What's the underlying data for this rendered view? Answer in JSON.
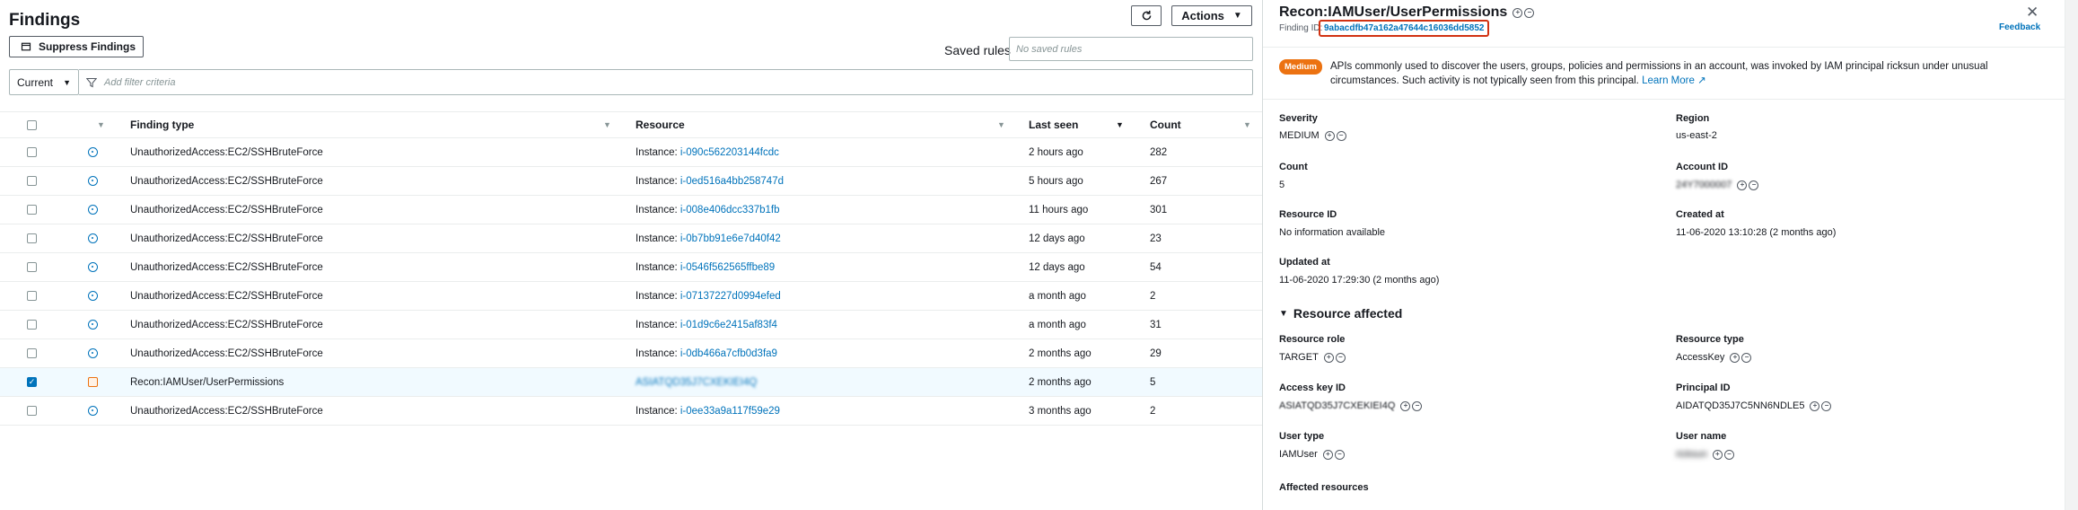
{
  "findings": {
    "title": "Findings",
    "suppress_label": "Suppress Findings",
    "actions_label": "Actions",
    "saved_rules_label": "Saved rules",
    "saved_rules_placeholder": "No saved rules",
    "current_filter": "Current",
    "filter_placeholder": "Add filter criteria",
    "columns": {
      "finding_type": "Finding type",
      "resource": "Resource",
      "last_seen": "Last seen",
      "count": "Count"
    },
    "rows": [
      {
        "type": "UnauthorizedAccess:EC2/SSHBruteForce",
        "res_prefix": "Instance: ",
        "res_id": "i-090c562203144fcdc",
        "seen": "2 hours ago",
        "count": "282"
      },
      {
        "type": "UnauthorizedAccess:EC2/SSHBruteForce",
        "res_prefix": "Instance: ",
        "res_id": "i-0ed516a4bb258747d",
        "seen": "5 hours ago",
        "count": "267"
      },
      {
        "type": "UnauthorizedAccess:EC2/SSHBruteForce",
        "res_prefix": "Instance: ",
        "res_id": "i-008e406dcc337b1fb",
        "seen": "11 hours ago",
        "count": "301"
      },
      {
        "type": "UnauthorizedAccess:EC2/SSHBruteForce",
        "res_prefix": "Instance: ",
        "res_id": "i-0b7bb91e6e7d40f42",
        "seen": "12 days ago",
        "count": "23"
      },
      {
        "type": "UnauthorizedAccess:EC2/SSHBruteForce",
        "res_prefix": "Instance: ",
        "res_id": "i-0546f562565ffbe89",
        "seen": "12 days ago",
        "count": "54"
      },
      {
        "type": "UnauthorizedAccess:EC2/SSHBruteForce",
        "res_prefix": "Instance: ",
        "res_id": "i-07137227d0994efed",
        "seen": "a month ago",
        "count": "2"
      },
      {
        "type": "UnauthorizedAccess:EC2/SSHBruteForce",
        "res_prefix": "Instance: ",
        "res_id": "i-01d9c6e2415af83f4",
        "seen": "a month ago",
        "count": "31"
      },
      {
        "type": "UnauthorizedAccess:EC2/SSHBruteForce",
        "res_prefix": "Instance: ",
        "res_id": "i-0db466a7cfb0d3fa9",
        "seen": "2 months ago",
        "count": "29"
      },
      {
        "type": "Recon:IAMUser/UserPermissions",
        "res_prefix": "",
        "res_id": "ASIATQD35J7CXEKIEI4Q",
        "seen": "2 months ago",
        "count": "5",
        "selected": true
      },
      {
        "type": "UnauthorizedAccess:EC2/SSHBruteForce",
        "res_prefix": "Instance: ",
        "res_id": "i-0ee33a9a117f59e29",
        "seen": "3 months ago",
        "count": "2"
      }
    ]
  },
  "detail": {
    "title": "Recon:IAMUser/UserPermissions",
    "finding_id_label": "Finding ID:",
    "finding_id": "9abacdfb47a162a47644c16036dd5852",
    "feedback_label": "Feedback",
    "severity_badge": "Medium",
    "description": "APIs commonly used to discover the users, groups, policies and permissions in an account, was invoked by IAM principal ricksun under unusual circumstances. Such activity is not typically seen from this principal.",
    "learn_more": "Learn More",
    "severity_label": "Severity",
    "severity_value": "MEDIUM",
    "region_label": "Region",
    "region_value": "us-east-2",
    "count_label": "Count",
    "count_value": "5",
    "account_label": "Account ID",
    "account_value": "24Y7000007",
    "resource_id_label": "Resource ID",
    "resource_id_value": "No information available",
    "created_label": "Created at",
    "created_value": "11-06-2020 13:10:28 (2 months ago)",
    "updated_label": "Updated at",
    "updated_value": "11-06-2020 17:29:30 (2 months ago)",
    "resource_affected": "Resource affected",
    "role_label": "Resource role",
    "role_value": "TARGET",
    "type_label": "Resource type",
    "type_value": "AccessKey",
    "access_key_label": "Access key ID",
    "access_key_value": "ASIATQD35J7CXEKIEI4Q",
    "principal_label": "Principal ID",
    "principal_value": "AIDATQD35J7C5NN6NDLE5",
    "user_type_label": "User type",
    "user_type_value": "IAMUser",
    "user_name_label": "User name",
    "user_name_value": "ricksun",
    "affected_resources_label": "Affected resources"
  }
}
